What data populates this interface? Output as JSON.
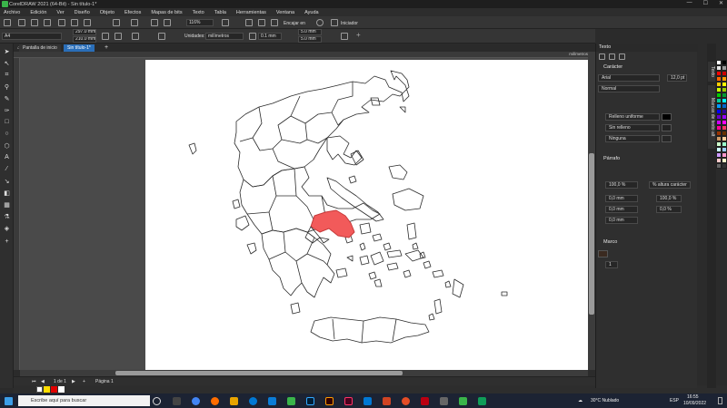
{
  "window": {
    "title": "CorelDRAW 2021 (64-Bit) - Sin título-1*"
  },
  "menu": [
    "Archivo",
    "Edición",
    "Ver",
    "Diseño",
    "Objeto",
    "Efectos",
    "Mapas de bits",
    "Texto",
    "Tabla",
    "Herramientas",
    "Ventana",
    "Ayuda"
  ],
  "toolbar1": {
    "zoom": "116%",
    "snap": "Encajar en",
    "launch": "Iniciador"
  },
  "toolbar2": {
    "page_size": "A4",
    "width": "297.0 mm",
    "height": "210.0 mm",
    "units_label": "Unidades:",
    "units": "milímetros",
    "nudge": "0.1 mm",
    "dup_x": "5.0 mm",
    "dup_y": "5.0 mm"
  },
  "doc_tabs": {
    "home": "Pantalla de inicio",
    "doc": "Sin título-1*"
  },
  "ruler": {
    "unit": "milímetros"
  },
  "status": {
    "pager": "1 de 1",
    "page_tab": "Página 1"
  },
  "docker": {
    "title": "Texto",
    "character": {
      "header": "Carácter",
      "font": "Arial",
      "size": "12,0 pt",
      "style": "Normal",
      "fill_type": "Relleno uniforme",
      "bg_fill": "Sin relleno",
      "outline": "Ninguna"
    },
    "paragraph": {
      "header": "Párrafo",
      "line_spacing": "100,0 %",
      "spacing_unit": "% altura carácter",
      "before": "0,0 mm",
      "after": "0,0 mm",
      "indent": "0,0 mm",
      "char_spacing": "100,0 %",
      "word_spacing": "0,0 %"
    },
    "frame": {
      "header": "Marco",
      "columns": "1"
    }
  },
  "docker_tabs": [
    "Texto",
    "Marcas de texto alt",
    "Sugerencias"
  ],
  "taskbar": {
    "search": "Escribe aquí para buscar",
    "weather": "30°C Nublado",
    "lang": "ESP",
    "time": "16:55",
    "date": "10/09/2022"
  },
  "colors": {
    "highlight": "#f25a5a",
    "palette": [
      "#ffffff",
      "#000000",
      "#e6e6e6",
      "#999999",
      "#ff0000",
      "#cc0000",
      "#ff6600",
      "#ff9900",
      "#ffcc00",
      "#ffff00",
      "#ccff00",
      "#99cc00",
      "#00cc00",
      "#009933",
      "#00cc99",
      "#00ffff",
      "#0099ff",
      "#0066cc",
      "#0000ff",
      "#330099",
      "#6600cc",
      "#9900ff",
      "#cc00ff",
      "#ff00ff",
      "#ff0099",
      "#ff3366",
      "#993300",
      "#663300",
      "#cc9966",
      "#ffcc99",
      "#ccffcc",
      "#99ffcc",
      "#ccffff",
      "#99ccff",
      "#cc99ff",
      "#ff99cc",
      "#ffcccc",
      "#ffffcc",
      "#666666",
      "#333333"
    ]
  }
}
